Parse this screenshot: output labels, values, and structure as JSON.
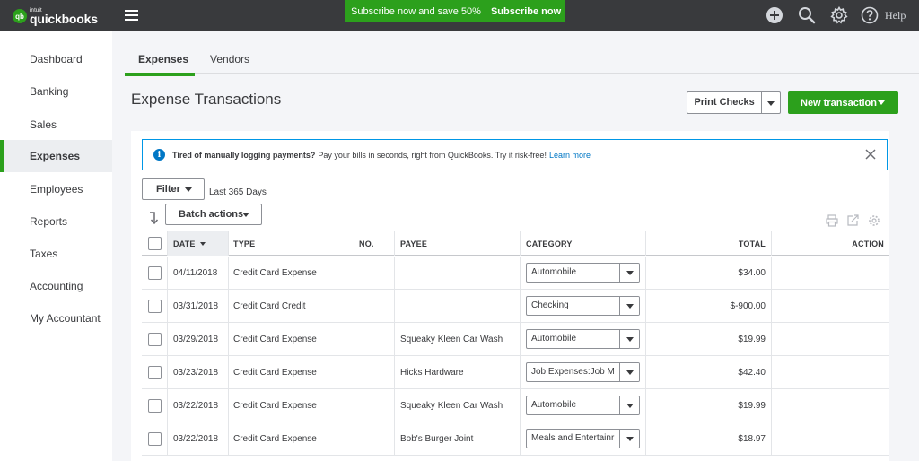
{
  "app": {
    "logo_mark": "qb",
    "logo_brand": "intuit",
    "logo_name": "quickbooks"
  },
  "promo": {
    "text": "Subscribe now and save 50%",
    "link": "Subscribe now"
  },
  "topbar": {
    "icons": [
      "plus-icon",
      "search-icon",
      "gear-icon",
      "help-icon"
    ],
    "help_label": "Help"
  },
  "sidebar": {
    "items": [
      {
        "label": "Dashboard"
      },
      {
        "label": "Banking"
      },
      {
        "label": "Sales"
      },
      {
        "label": "Expenses",
        "active": true
      },
      {
        "label": "Employees"
      },
      {
        "label": "Reports"
      },
      {
        "label": "Taxes"
      },
      {
        "label": "Accounting"
      },
      {
        "label": "My Accountant"
      }
    ]
  },
  "tabs": [
    {
      "label": "Expenses",
      "active": true
    },
    {
      "label": "Vendors"
    }
  ],
  "page": {
    "title": "Expense Transactions",
    "print_checks_label": "Print Checks",
    "new_transaction_label": "New transaction"
  },
  "banner": {
    "icon": "info-icon",
    "bold": "Tired of manually logging payments?",
    "text": "Pay your bills in seconds, right from QuickBooks. Try it risk-free!",
    "link": "Learn more"
  },
  "toolbar": {
    "filter_label": "Filter",
    "filter_note": "Last 365 Days",
    "batch_label": "Batch actions"
  },
  "table": {
    "headers": {
      "date": "DATE",
      "type": "TYPE",
      "no": "NO.",
      "payee": "PAYEE",
      "category": "CATEGORY",
      "total": "TOTAL",
      "action": "ACTION"
    },
    "rows": [
      {
        "date": "04/11/2018",
        "type": "Credit Card Expense",
        "no": "",
        "payee": "",
        "category": "Automobile",
        "total": "$34.00"
      },
      {
        "date": "03/31/2018",
        "type": "Credit Card Credit",
        "no": "",
        "payee": "",
        "category": "Checking",
        "total": "$-900.00"
      },
      {
        "date": "03/29/2018",
        "type": "Credit Card Expense",
        "no": "",
        "payee": "Squeaky Kleen Car Wash",
        "category": "Automobile",
        "total": "$19.99"
      },
      {
        "date": "03/23/2018",
        "type": "Credit Card Expense",
        "no": "",
        "payee": "Hicks Hardware",
        "category": "Job Expenses:Job M",
        "total": "$42.40"
      },
      {
        "date": "03/22/2018",
        "type": "Credit Card Expense",
        "no": "",
        "payee": "Squeaky Kleen Car Wash",
        "category": "Automobile",
        "total": "$19.99"
      },
      {
        "date": "03/22/2018",
        "type": "Credit Card Expense",
        "no": "",
        "payee": "Bob's Burger Joint",
        "category": "Meals and Entertainr",
        "total": "$18.97"
      }
    ]
  },
  "colors": {
    "topbar": "#393a3d",
    "brand_green": "#2ca01c",
    "link_blue": "#0077c5",
    "content_bg": "#f4f5f8"
  }
}
